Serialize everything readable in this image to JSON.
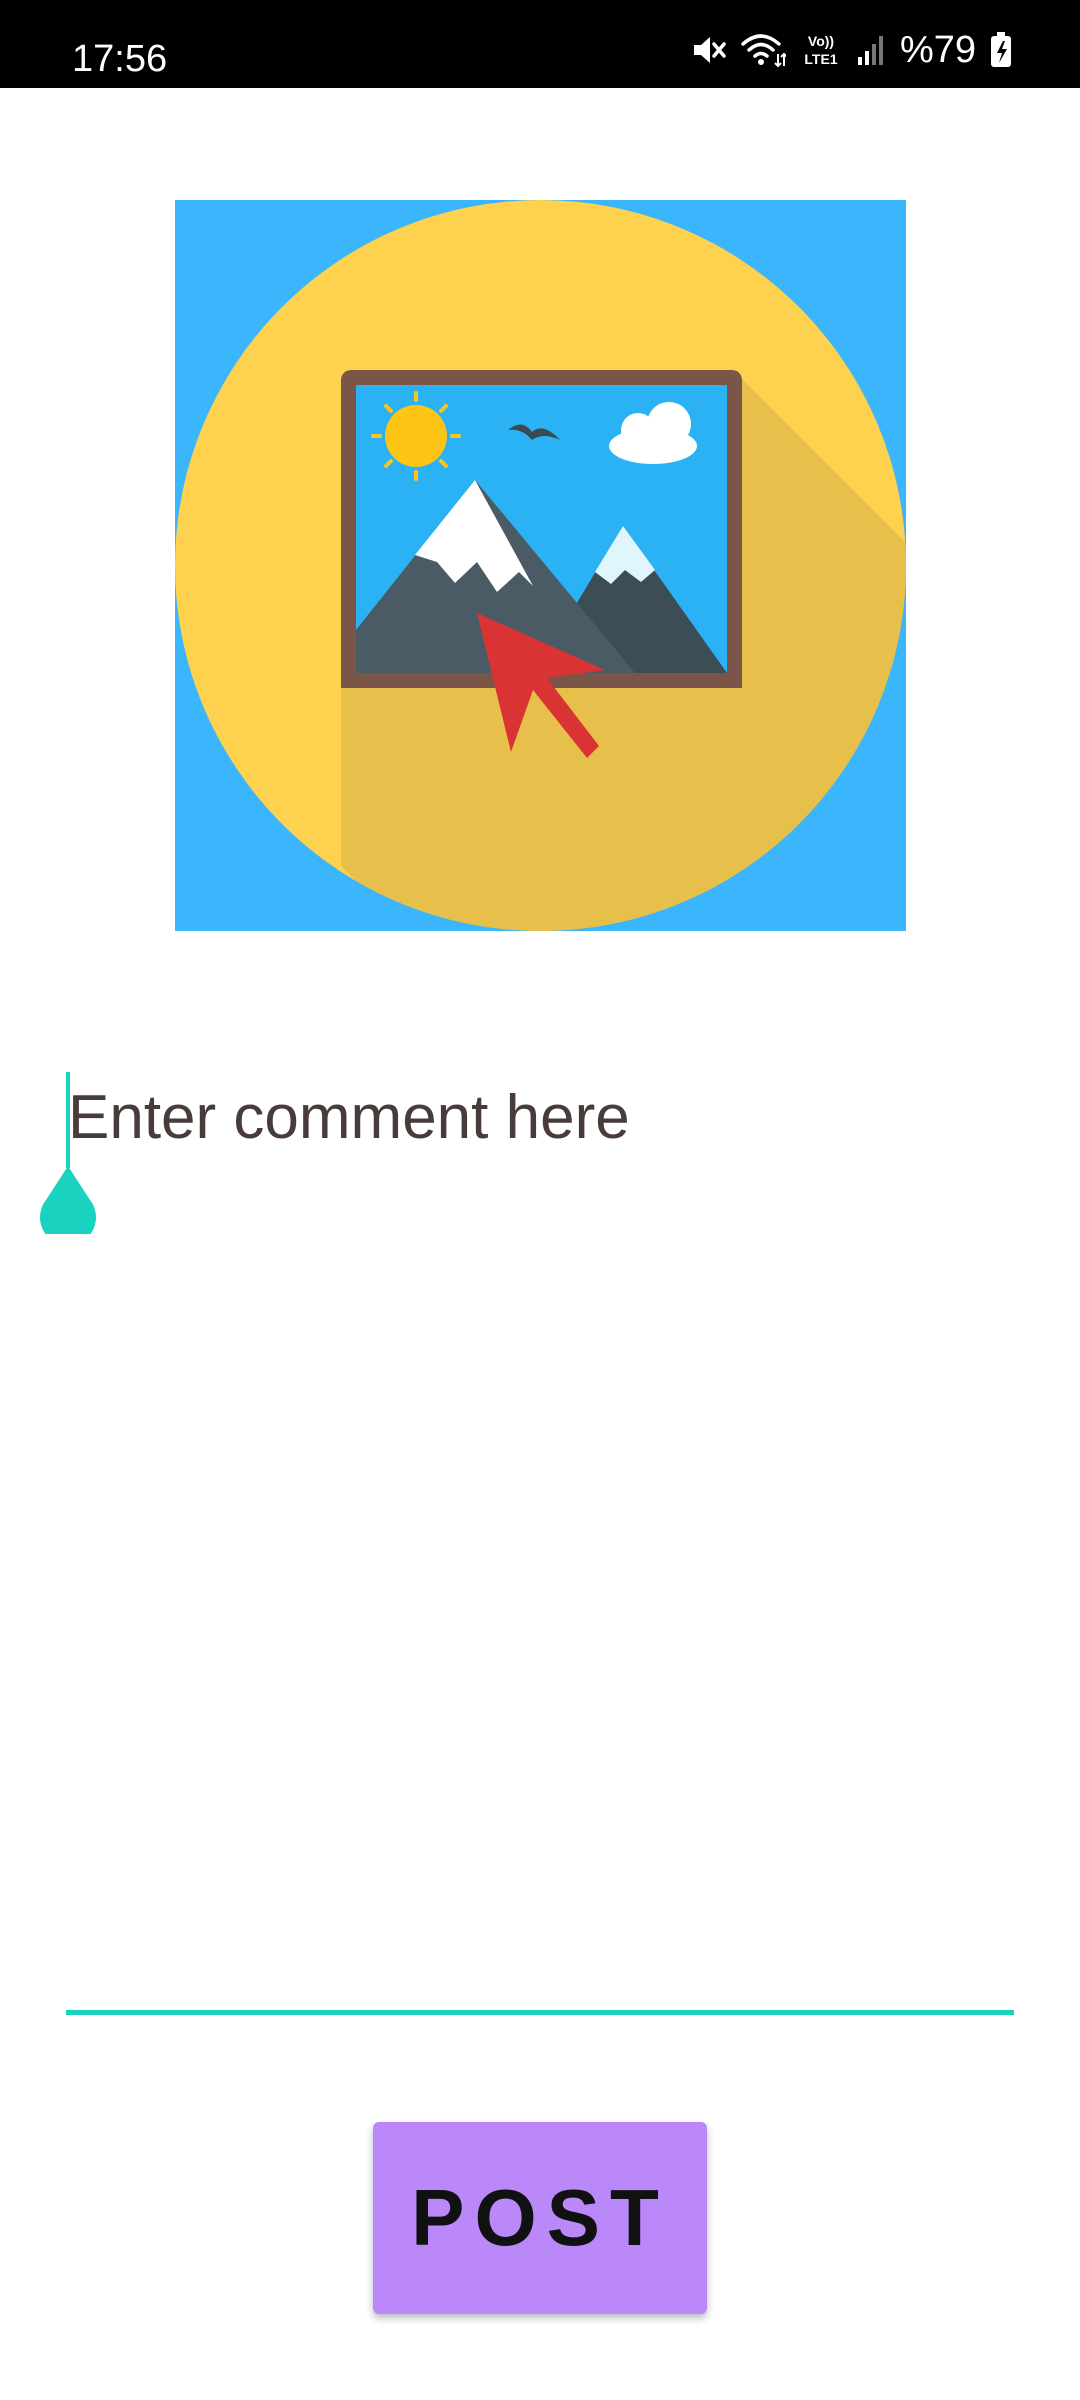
{
  "status_bar": {
    "time": "17:56",
    "battery": "%79",
    "icons": [
      "mute-icon",
      "wifi-icon",
      "volte-icon",
      "signal-icon",
      "battery-icon"
    ],
    "network_label_top": "Vo))",
    "network_label_bottom": "LTE1"
  },
  "hero_image": {
    "icon": "image-picker-icon",
    "colors": {
      "background": "#3bb5fb",
      "circle": "#fed24e",
      "frame": "#7a5548",
      "sky": "#2ab2f5",
      "cursor": "#d93333"
    }
  },
  "comment": {
    "placeholder": "Enter comment here",
    "value": ""
  },
  "actions": {
    "post_label": "POST"
  },
  "colors": {
    "accent": "#19d2bf",
    "button": "#ba88f8"
  }
}
